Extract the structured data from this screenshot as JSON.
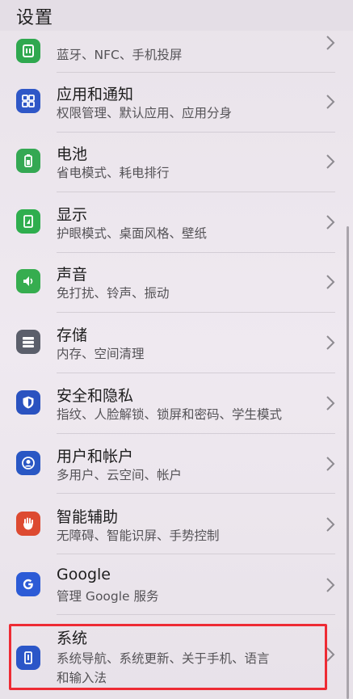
{
  "header": {
    "title": "设置"
  },
  "items": [
    {
      "name": "settings-item-device-connection",
      "icon": "device-connection-icon",
      "color": "#2fa84f",
      "title": "",
      "subtitle": "蓝牙、NFC、手机投屏"
    },
    {
      "name": "settings-item-apps",
      "icon": "apps-grid-icon",
      "color": "#2f57c7",
      "title": "应用和通知",
      "subtitle": "权限管理、默认应用、应用分身"
    },
    {
      "name": "settings-item-battery",
      "icon": "battery-icon",
      "color": "#34a853",
      "title": "电池",
      "subtitle": "省电模式、耗电排行"
    },
    {
      "name": "settings-item-display",
      "icon": "display-icon",
      "color": "#2fae4e",
      "title": "显示",
      "subtitle": "护眼模式、桌面风格、壁纸"
    },
    {
      "name": "settings-item-sound",
      "icon": "speaker-icon",
      "color": "#36ad4f",
      "title": "声音",
      "subtitle": "免打扰、铃声、振动"
    },
    {
      "name": "settings-item-storage",
      "icon": "storage-icon",
      "color": "#5b5f6b",
      "title": "存储",
      "subtitle": "内存、空间清理"
    },
    {
      "name": "settings-item-security",
      "icon": "shield-icon",
      "color": "#2a52c0",
      "title": "安全和隐私",
      "subtitle": "指纹、人脸解锁、锁屏和密码、学生模式"
    },
    {
      "name": "settings-item-accounts",
      "icon": "user-account-icon",
      "color": "#2957c4",
      "title": "用户和帐户",
      "subtitle": "多用户、云空间、帐户"
    },
    {
      "name": "settings-item-accessibility",
      "icon": "hand-icon",
      "color": "#dd4a31",
      "title": "智能辅助",
      "subtitle": "无障碍、智能识屏、手势控制"
    },
    {
      "name": "settings-item-google",
      "icon": "google-icon",
      "color": "#2c5bd6",
      "title": "Google",
      "subtitle": "管理 Google 服务"
    },
    {
      "name": "settings-item-system",
      "icon": "system-phone-icon",
      "color": "#2b56c8",
      "title": "系统",
      "subtitle": "系统导航、系统更新、关于手机、语言",
      "subtitle2": "和输入法"
    }
  ]
}
